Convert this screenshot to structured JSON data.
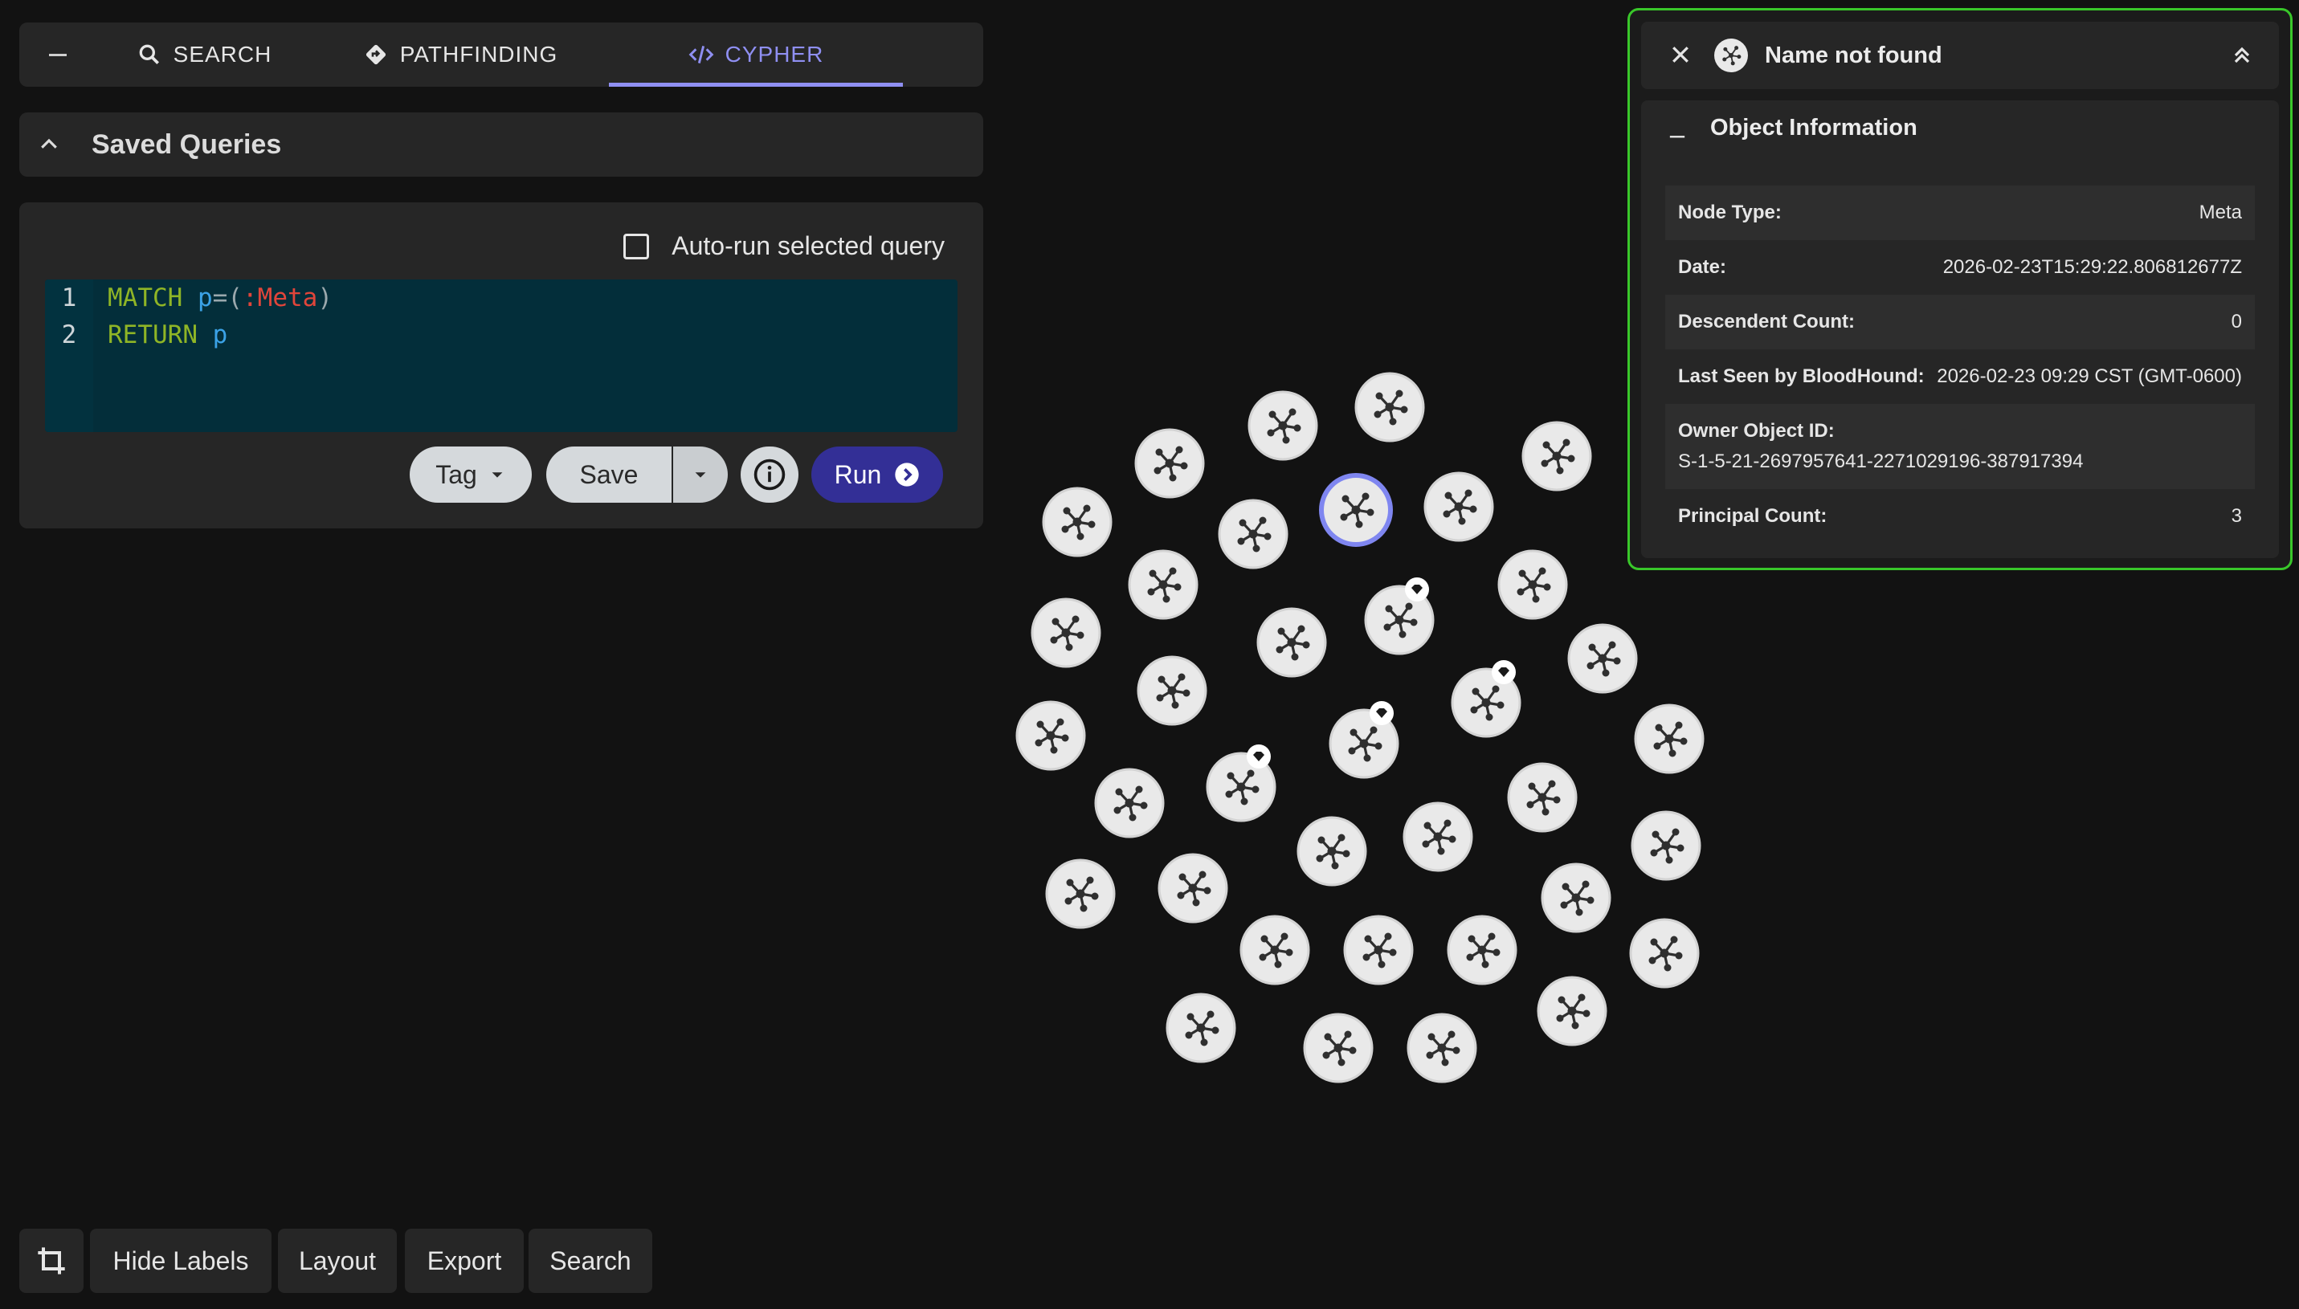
{
  "tabs": {
    "search": "SEARCH",
    "pathfinding": "PATHFINDING",
    "cypher": "CYPHER"
  },
  "saved_queries": {
    "title": "Saved Queries"
  },
  "editor": {
    "autorun_label": "Auto-run selected query",
    "line1": {
      "num": "1",
      "kw": "MATCH",
      "var": "p",
      "eq": "=(",
      "label": ":Meta",
      "close": ")"
    },
    "line2": {
      "num": "2",
      "kw": "RETURN",
      "var": "p"
    }
  },
  "buttons": {
    "tag": "Tag",
    "save": "Save",
    "run": "Run"
  },
  "toolbar": {
    "hide_labels": "Hide Labels",
    "layout": "Layout",
    "export": "Export",
    "search": "Search"
  },
  "panel": {
    "title": "Name not found",
    "section": "Object Information",
    "node_type_k": "Node Type:",
    "node_type_v": "Meta",
    "date_k": "Date:",
    "date_v": "2026-02-23T15:29:22.806812677Z",
    "desc_k": "Descendent Count:",
    "desc_v": "0",
    "lastseen_k": "Last Seen by BloodHound:",
    "lastseen_v": "2026-02-23 09:29 CST (GMT-0600)",
    "owner_k": "Owner Object ID:",
    "owner_v": "S-1-5-21-2697957641-2271029196-387917394",
    "principal_k": "Principal Count:",
    "principal_v": "3"
  },
  "colors": {
    "accent": "#8f8ff2",
    "run": "#332f96",
    "panel_border": "#39c72a"
  },
  "icons": [
    "minus-icon",
    "search-icon",
    "pathfinding-icon",
    "code-icon",
    "chevron-up-icon",
    "chevron-down-icon",
    "info-icon",
    "arrow-right-circle-icon",
    "crop-icon",
    "close-icon",
    "meta-node-icon",
    "double-chevron-up-icon",
    "diamond-badge-icon"
  ]
}
